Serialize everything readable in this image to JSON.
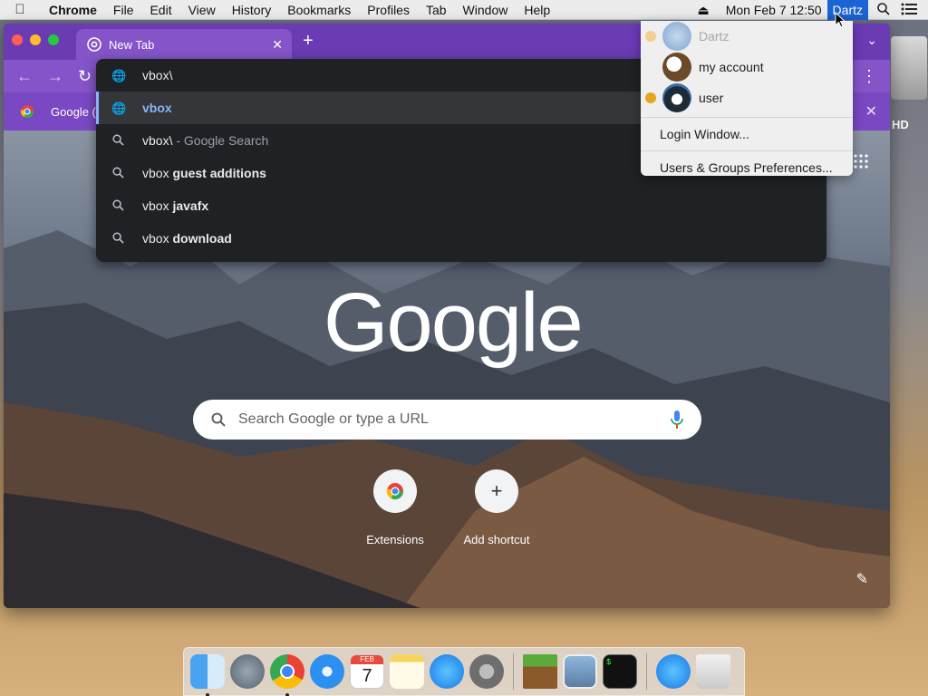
{
  "menubar": {
    "app_name": "Chrome",
    "items": [
      "File",
      "Edit",
      "View",
      "History",
      "Bookmarks",
      "Profiles",
      "Tab",
      "Window",
      "Help"
    ],
    "clock": "Mon Feb 7  12:50",
    "user": "Dartz"
  },
  "desktop": {
    "drive_label": "HD"
  },
  "browser": {
    "tab_title": "New Tab",
    "bookmark_label": "Google (",
    "omnibox": {
      "typed": "vbox\\",
      "rows": [
        {
          "kind": "url",
          "text": "vbox"
        },
        {
          "kind": "search",
          "prefix": "vbox\\",
          "suffix": " - Google Search"
        },
        {
          "kind": "search",
          "prefix": "vbox ",
          "bold": "guest additions"
        },
        {
          "kind": "search",
          "prefix": "vbox ",
          "bold": "javafx"
        },
        {
          "kind": "search",
          "prefix": "vbox ",
          "bold": "download"
        }
      ]
    },
    "ntp": {
      "logo": "Google",
      "search_placeholder": "Search Google or type a URL",
      "shortcuts": [
        "Extensions",
        "Add shortcut"
      ]
    }
  },
  "user_menu": {
    "users": [
      {
        "name": "Dartz",
        "state": "current"
      },
      {
        "name": "my account",
        "state": "normal"
      },
      {
        "name": "user",
        "state": "logged-in"
      }
    ],
    "items": [
      "Login Window...",
      "Users & Groups Preferences..."
    ]
  },
  "dock": {
    "icons": [
      "finder-icon",
      "launchpad-icon",
      "chrome-icon",
      "safari-icon",
      "calendar-icon",
      "notes-icon",
      "app-store-icon",
      "system-preferences-icon",
      "minecraft-icon",
      "preview-icon",
      "terminal-icon",
      "downloads-icon",
      "trash-icon"
    ],
    "calendar_month": "FEB",
    "calendar_day": "7"
  },
  "colors": {
    "accent": "#8454c8",
    "omnibox_bg": "#202124",
    "link": "#8ab4f8"
  }
}
